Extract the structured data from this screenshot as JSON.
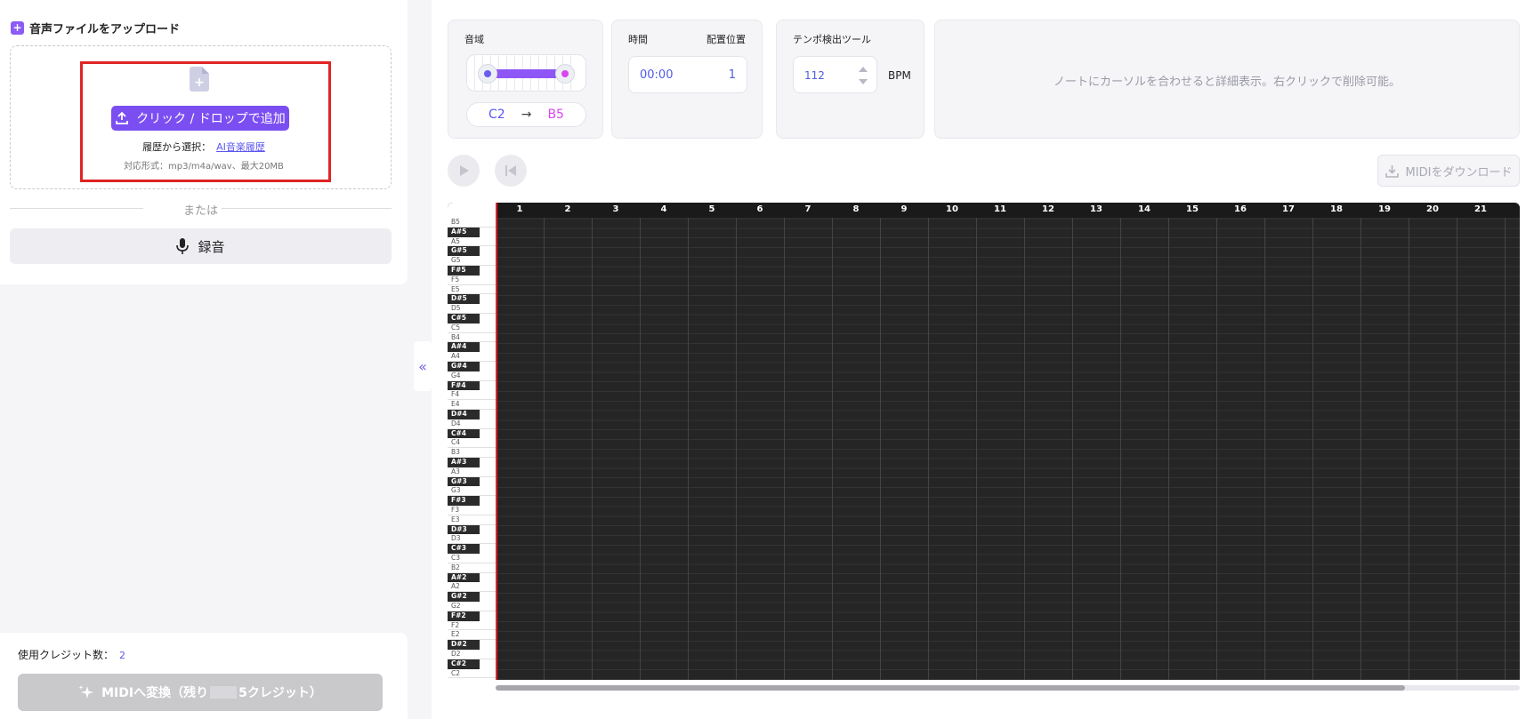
{
  "upload": {
    "title": "音声ファイルをアップロード",
    "button_label": "クリック / ドロップで追加",
    "history_prefix": "履歴から選択：",
    "history_link": "AI音楽履歴",
    "formats": "対応形式：mp3/m4a/wav、最大20MB",
    "or_label": "または",
    "record_label": "録音"
  },
  "credits": {
    "label": "使用クレジット数：",
    "value": "2",
    "convert_label": "MIDIへ変換（残り",
    "convert_suffix": "5クレジット）"
  },
  "range": {
    "label": "音域",
    "low": "C2",
    "arrow": "→",
    "high": "B5"
  },
  "time": {
    "time_label": "時間",
    "position_label": "配置位置",
    "time_value": "00:00",
    "position_value": "1"
  },
  "tempo": {
    "label": "テンポ検出ツール",
    "value": "112",
    "unit": "BPM"
  },
  "info": {
    "hint": "ノートにカーソルを合わせると詳細表示。右クリックで削除可能。"
  },
  "toolbar": {
    "download_label": "MIDIをダウンロード"
  },
  "piano_roll": {
    "columns": [
      "1",
      "2",
      "3",
      "4",
      "5",
      "6",
      "7",
      "8",
      "9",
      "10",
      "11",
      "12",
      "13",
      "14",
      "15",
      "16",
      "17",
      "18",
      "19",
      "20",
      "21"
    ],
    "keys": [
      "B5",
      "A#5",
      "A5",
      "G#5",
      "G5",
      "F#5",
      "F5",
      "E5",
      "D#5",
      "D5",
      "C#5",
      "C5",
      "B4",
      "A#4",
      "A4",
      "G#4",
      "G4",
      "F#4",
      "F4",
      "E4",
      "D#4",
      "D4",
      "C#4",
      "C4",
      "B3",
      "A#3",
      "A3",
      "G#3",
      "G3",
      "F#3",
      "F3",
      "E3",
      "D#3",
      "D3",
      "C#3",
      "C3",
      "B2",
      "A#2",
      "A2",
      "G#2",
      "G2",
      "F#2",
      "F2",
      "E2",
      "D#2",
      "D2",
      "C#2",
      "C2"
    ]
  },
  "colors": {
    "accent": "#7b4ef2",
    "highlight_box": "#e02424",
    "link": "#5b56f0",
    "note_high": "#d946ef"
  }
}
